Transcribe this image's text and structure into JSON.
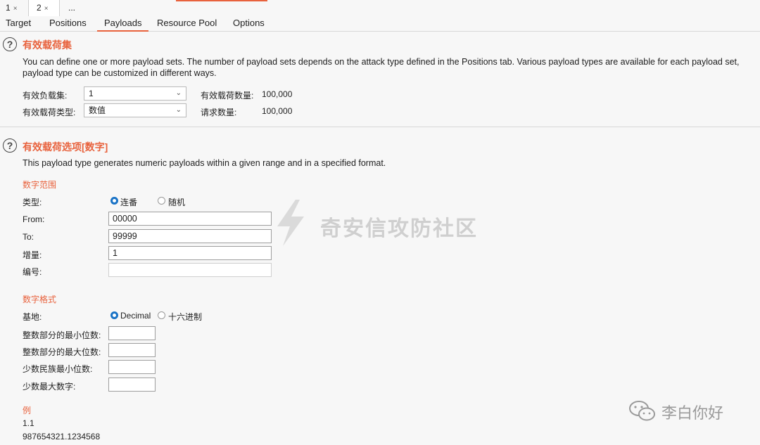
{
  "window_tabs": [
    {
      "label": "1",
      "close": "×"
    },
    {
      "label": "2",
      "close": "×"
    },
    {
      "label": "..."
    }
  ],
  "sub_tabs": [
    "Target",
    "Positions",
    "Payloads",
    "Resource Pool",
    "Options"
  ],
  "active_sub_tab": "Payloads",
  "payload_sets": {
    "title": "有效载荷集",
    "description_line1": "You can define one or more payload sets. The number of payload sets depends on the attack type defined in the Positions tab. Various payload types are available for each payload set,",
    "description_line2": "payload type can be customized in different ways.",
    "set_label": "有效负载集:",
    "set_value": "1",
    "type_label": "有效载荷类型:",
    "type_value": "数值",
    "count_label": "有效载荷数量:",
    "count_value": "100,000",
    "request_label": "请求数量:",
    "request_value": "100,000"
  },
  "payload_options": {
    "title": "有效载荷选项[数字]",
    "description": "This payload type generates numeric payloads within a given range and in a specified format.",
    "range_heading": "数字范围",
    "type_label": "类型:",
    "radio_sequential": "连番",
    "radio_random": "随机",
    "from_label": "From:",
    "from_value": "00000",
    "to_label": "To:",
    "to_value": "99999",
    "step_label": "增量:",
    "step_value": "1",
    "number_label": "编号:",
    "number_value": "",
    "format_heading": "数字格式",
    "base_label": "基地:",
    "radio_decimal": "Decimal",
    "radio_hex": "十六进制",
    "min_int_label": "整数部分的最小位数:",
    "max_int_label": "整数部分的最大位数:",
    "min_frac_label": "少数民族最小位数:",
    "max_frac_label": "少数最大数字:",
    "example_heading": "例",
    "example_1": "1.1",
    "example_2": "987654321.1234568"
  },
  "watermarks": {
    "center": "奇安信攻防社区",
    "corner": "李白你好"
  },
  "colors": {
    "accent": "#e8623d",
    "radio_selected": "#1a73c6"
  }
}
